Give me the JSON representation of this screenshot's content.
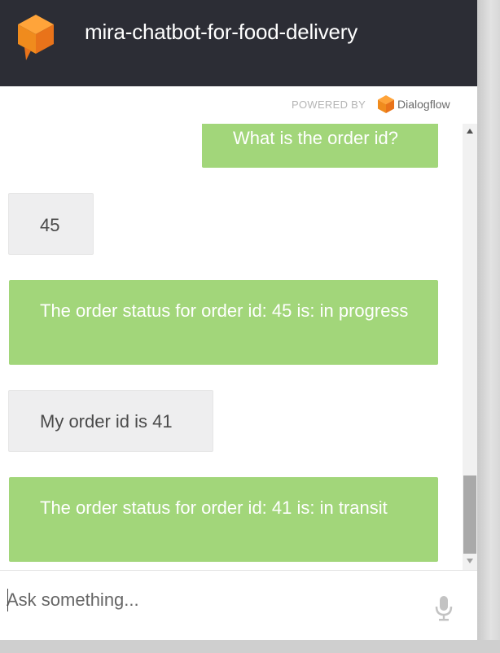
{
  "header": {
    "title": "mira-chatbot-for-food-delivery",
    "logo_icon": "dialogflow-cube-icon",
    "background_color": "#2c2d35"
  },
  "powered_by": {
    "label": "POWERED BY",
    "brand": "Dialogflow",
    "brand_icon": "dialogflow-logo-icon"
  },
  "messages": [
    {
      "sender": "bot",
      "text": "What is the order id?"
    },
    {
      "sender": "user",
      "text": "45"
    },
    {
      "sender": "bot",
      "text": "The order status for order id: 45 is: in progress"
    },
    {
      "sender": "user",
      "text": "My order id is 41"
    },
    {
      "sender": "bot",
      "text": "The order status for order id: 41 is: in transit"
    }
  ],
  "input": {
    "placeholder": "Ask something...",
    "value": "",
    "mic_icon": "microphone-icon"
  },
  "colors": {
    "bot_bubble": "#a2d67a",
    "user_bubble": "#eeeeef",
    "accent_orange": "#ef8a1c"
  }
}
